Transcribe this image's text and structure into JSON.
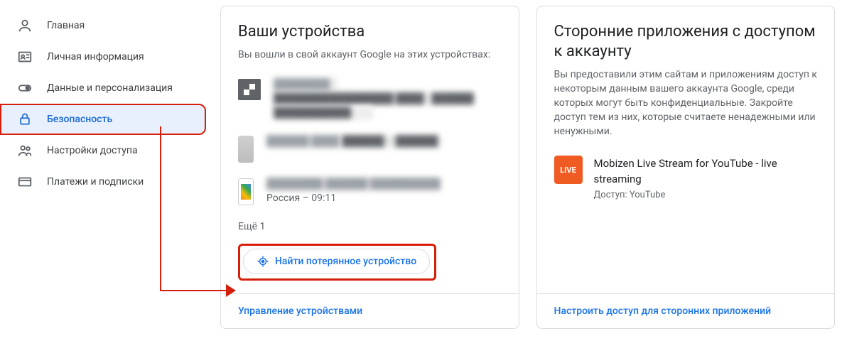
{
  "sidebar": {
    "items": [
      {
        "label": "Главная",
        "selected": false
      },
      {
        "label": "Личная информация",
        "selected": false
      },
      {
        "label": "Данные и персонализация",
        "selected": false
      },
      {
        "label": "Безопасность",
        "selected": true
      },
      {
        "label": "Настройки доступа",
        "selected": false
      },
      {
        "label": "Платежи и подписки",
        "selected": false
      }
    ]
  },
  "devicesCard": {
    "title": "Ваши устройства",
    "desc": "Вы вошли в свой аккаунт Google на этих устройствах:",
    "devices": [
      {
        "name": "████████",
        "line1": "█████████████████ ████ · ██████",
        "line2": "███████████",
        "redacted": true
      },
      {
        "name": "██████ ████",
        "line1": "██████ – ██████",
        "line2": "",
        "redacted": true
      },
      {
        "name": "████████ ██████ ██████████",
        "line1": "Россия – 09:11",
        "line2": "",
        "redacted": false
      }
    ],
    "moreCount": "Ещё 1",
    "findButton": "Найти потерянное устройство",
    "footerLink": "Управление устройствами"
  },
  "appsCard": {
    "title": "Сторонние приложения с доступом к аккаунту",
    "desc": "Вы предоставили этим сайтам и приложениям доступ к некоторым данным вашего аккаунта Google, среди которых могут быть конфиденциальные. Закройте доступ тем из них, которые считаете ненадежными или ненужными.",
    "app": {
      "badge": "LIVE",
      "name": "Mobizen Live Stream for YouTube - live streaming",
      "access": "Доступ: YouTube"
    },
    "footerLink": "Настроить доступ для сторонних приложений"
  }
}
